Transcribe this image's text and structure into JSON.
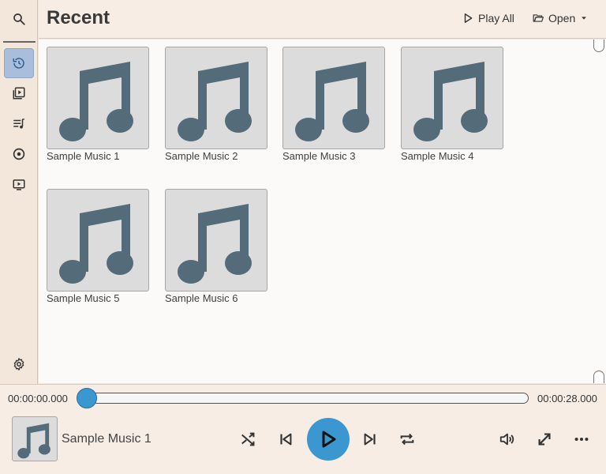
{
  "header": {
    "title": "Recent",
    "play_all_label": "Play All",
    "open_label": "Open"
  },
  "sidebar": {
    "items": [
      {
        "icon": "search-icon"
      },
      {
        "icon": "history-icon",
        "active": true
      },
      {
        "icon": "video-library-icon"
      },
      {
        "icon": "playlist-icon"
      },
      {
        "icon": "disc-icon"
      },
      {
        "icon": "video-icon"
      },
      {
        "icon": "gear-icon"
      }
    ]
  },
  "library": {
    "items": [
      {
        "label": "Sample Music 1"
      },
      {
        "label": "Sample Music 2"
      },
      {
        "label": "Sample Music 3"
      },
      {
        "label": "Sample Music 4"
      },
      {
        "label": "Sample Music 5"
      },
      {
        "label": "Sample Music 6"
      }
    ]
  },
  "player": {
    "current_time": "00:00:00.000",
    "total_time": "00:00:28.000",
    "progress": 0,
    "track_name": "Sample Music 1"
  },
  "colors": {
    "accent": "#3b97d0",
    "note": "#546b7a",
    "background": "#f3e6da"
  }
}
